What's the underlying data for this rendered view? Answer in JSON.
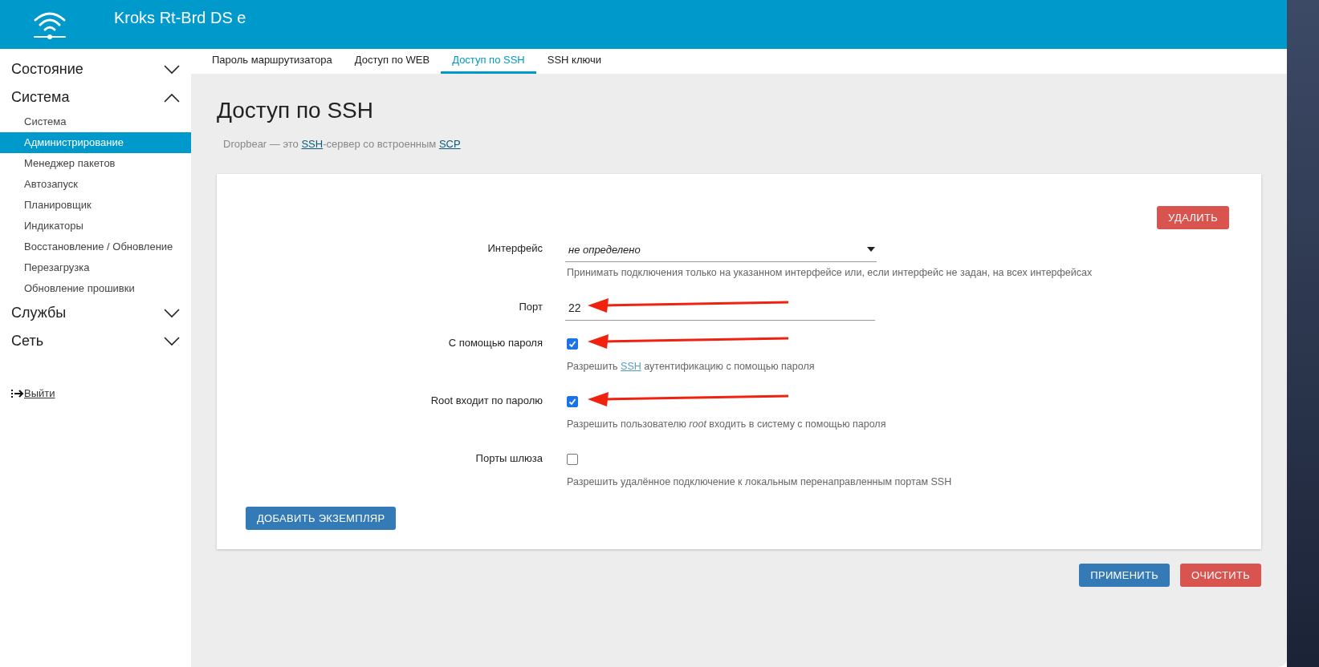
{
  "header": {
    "title": "Kroks Rt-Brd DS e"
  },
  "sidebar": {
    "sections": [
      {
        "label": "Состояние",
        "expanded": false
      },
      {
        "label": "Система",
        "expanded": true,
        "items": [
          {
            "label": "Система",
            "selected": false
          },
          {
            "label": "Администрирование",
            "selected": true
          },
          {
            "label": "Менеджер пакетов",
            "selected": false
          },
          {
            "label": "Автозапуск",
            "selected": false
          },
          {
            "label": "Планировщик",
            "selected": false
          },
          {
            "label": "Индикаторы",
            "selected": false
          },
          {
            "label": "Восстановление / Обновление",
            "selected": false
          },
          {
            "label": "Перезагрузка",
            "selected": false
          },
          {
            "label": "Обновление прошивки",
            "selected": false
          }
        ]
      },
      {
        "label": "Службы",
        "expanded": false
      },
      {
        "label": "Сеть",
        "expanded": false
      }
    ],
    "logout": "Выйти"
  },
  "tabs": [
    {
      "label": "Пароль маршрутизатора",
      "selected": false
    },
    {
      "label": "Доступ по WEB",
      "selected": false
    },
    {
      "label": "Доступ по SSH",
      "selected": true
    },
    {
      "label": "SSH ключи",
      "selected": false
    }
  ],
  "page": {
    "title": "Доступ по SSH",
    "description": [
      {
        "kind": "text",
        "text": "Dropbear — это "
      },
      {
        "kind": "link",
        "text": "SSH"
      },
      {
        "kind": "text",
        "text": "-сервер со встроенным "
      },
      {
        "kind": "link",
        "text": "SCP"
      }
    ]
  },
  "section": {
    "delete_button": "УДАЛИТЬ",
    "fields": [
      {
        "kind": "select",
        "label": "Интерфейс",
        "value": "не определено",
        "annotated": false,
        "help": [
          {
            "kind": "text",
            "text": "Принимать подключения только на указанном интерфейсе или, если интерфейс не задан, на всех интерфейсах"
          }
        ]
      },
      {
        "kind": "text",
        "label": "Порт",
        "value": "22",
        "annotated": true
      },
      {
        "kind": "checkbox",
        "label": "С помощью пароля",
        "checked": true,
        "annotated": true,
        "help": [
          {
            "kind": "text",
            "text": "Разрешить "
          },
          {
            "kind": "link",
            "text": "SSH"
          },
          {
            "kind": "text",
            "text": " аутентификацию с помощью пароля"
          }
        ]
      },
      {
        "kind": "checkbox",
        "label": "Root входит по паролю",
        "checked": true,
        "annotated": true,
        "help": [
          {
            "kind": "text",
            "text": "Разрешить пользователю *root* входить в систему с помощью пароля"
          }
        ]
      },
      {
        "kind": "checkbox",
        "label": "Порты шлюза",
        "checked": false,
        "annotated": false,
        "help": [
          {
            "kind": "text",
            "text": "Разрешить удалённое подключение к локальным перенаправленным портам SSH"
          }
        ]
      }
    ],
    "add_button": "ДОБАВИТЬ ЭКЗЕМПЛЯР"
  },
  "actions": [
    {
      "kind": "primary",
      "label": "ПРИМЕНИТЬ"
    },
    {
      "kind": "danger",
      "label": "ОЧИСТИТЬ"
    }
  ]
}
